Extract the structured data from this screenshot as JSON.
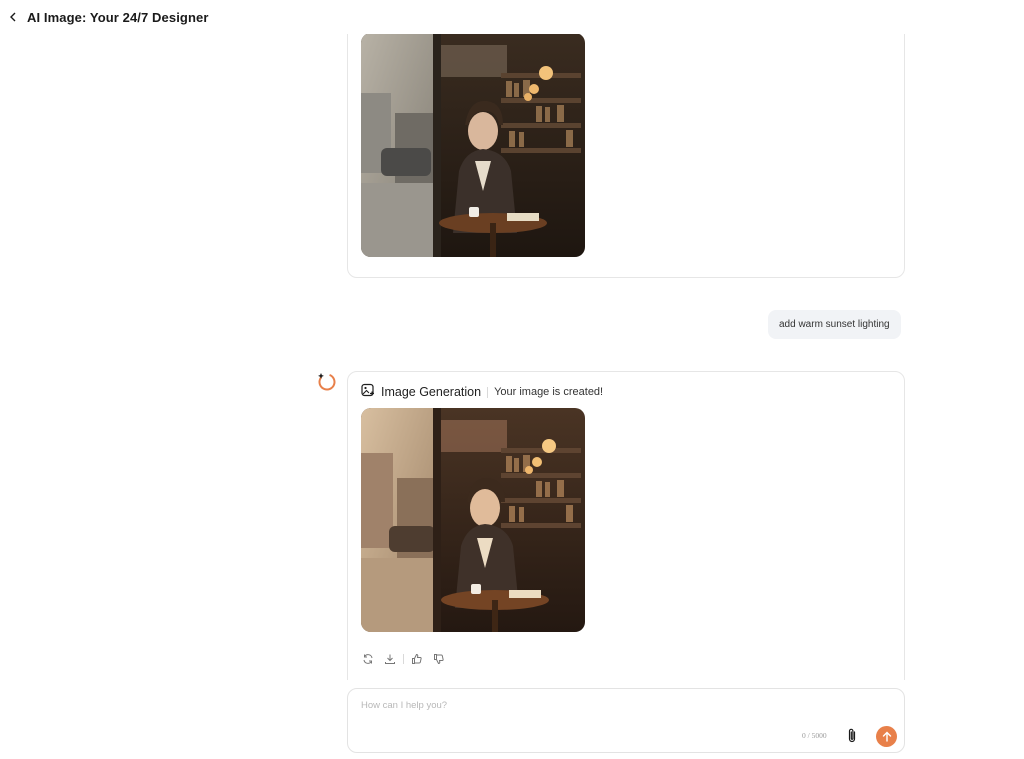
{
  "header": {
    "title": "AI Image: Your 24/7 Designer"
  },
  "conversation": {
    "user_message": "add warm sunset lighting",
    "generation": {
      "title": "Image Generation",
      "status": "Your image is created!"
    }
  },
  "composer": {
    "placeholder": "How can I help you?",
    "counter": "0 / 5000"
  },
  "colors": {
    "accent": "#e8804a",
    "bubble_bg": "#f1f3f6",
    "border": "#e6e6e6"
  },
  "icons": {
    "back": "chevron-left-icon",
    "image_generation": "image-generation-icon",
    "regenerate": "refresh-icon",
    "download": "download-icon",
    "like": "thumbs-up-icon",
    "dislike": "thumbs-down-icon",
    "attach": "paperclip-icon",
    "send": "arrow-up-icon"
  }
}
